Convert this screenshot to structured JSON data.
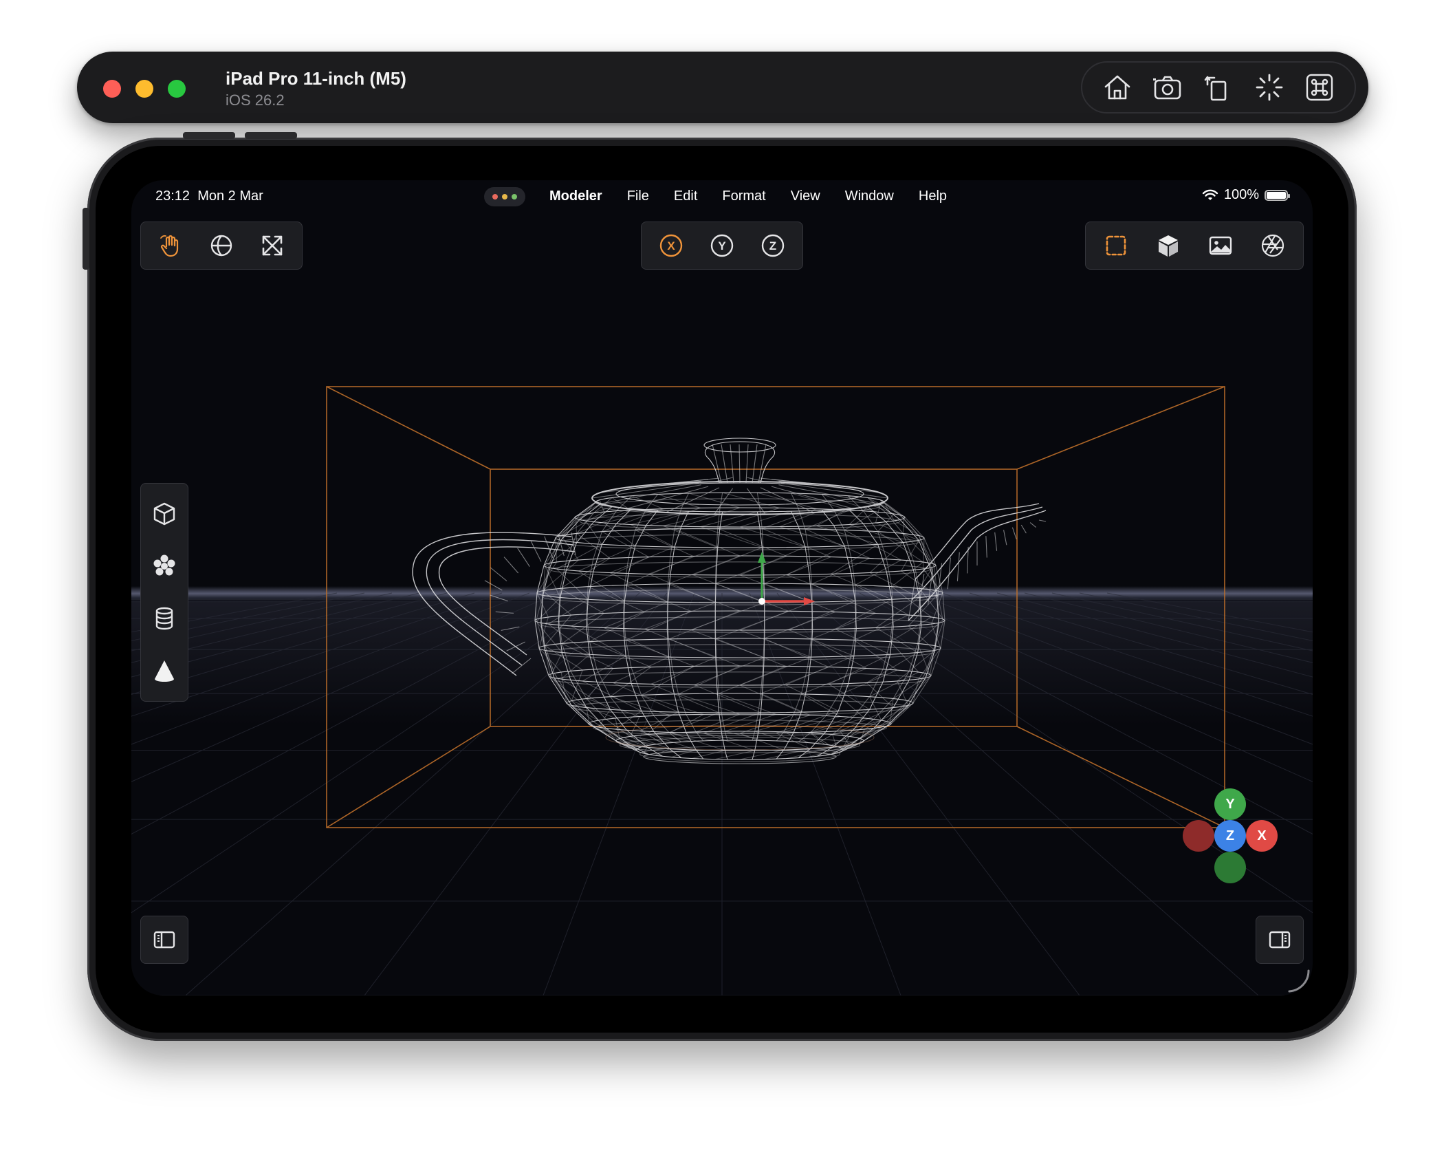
{
  "simulator": {
    "device_name": "iPad Pro 11-inch (M5)",
    "os_version": "iOS 26.2",
    "toolbar": [
      {
        "name": "home-icon",
        "label": "Home"
      },
      {
        "name": "camera-icon",
        "label": "Screenshot"
      },
      {
        "name": "rotate-icon",
        "label": "Rotate"
      },
      {
        "name": "loading-icon",
        "label": "Activity"
      },
      {
        "name": "command-icon",
        "label": "Keyboard"
      }
    ]
  },
  "status_bar": {
    "time": "23:12",
    "date": "Mon 2 Mar",
    "battery": "100%",
    "battery_level": 1.0
  },
  "menu_bar": {
    "app_name": "Modeler",
    "items": [
      "File",
      "Edit",
      "Format",
      "View",
      "Window",
      "Help"
    ]
  },
  "toolbar_left": {
    "items": [
      {
        "name": "hand-pan-icon",
        "active": true
      },
      {
        "name": "globe-orbit-icon",
        "active": false
      },
      {
        "name": "expand-arrows-icon",
        "active": false
      }
    ]
  },
  "toolbar_axis": {
    "items": [
      {
        "name": "axis-x-icon",
        "glyph": "X",
        "active": true
      },
      {
        "name": "axis-y-icon",
        "glyph": "Y",
        "active": false
      },
      {
        "name": "axis-z-icon",
        "glyph": "Z",
        "active": false
      }
    ]
  },
  "toolbar_right": {
    "items": [
      {
        "name": "selection-box-icon",
        "active": true
      },
      {
        "name": "solid-cube-icon",
        "active": false
      },
      {
        "name": "image-icon",
        "active": false
      },
      {
        "name": "aperture-icon",
        "active": false
      }
    ]
  },
  "primitives_toolbar": {
    "items": [
      {
        "name": "cube-outline-icon"
      },
      {
        "name": "sphere-cluster-icon"
      },
      {
        "name": "cylinder-icon"
      },
      {
        "name": "cone-icon"
      }
    ]
  },
  "gizmo": {
    "y_label": "Y",
    "x_label": "X",
    "z_label": "Z"
  },
  "colors": {
    "accent": "#f0943a",
    "bounding_box": "#c0702a",
    "axis_x": "#e04a45",
    "axis_y": "#3fa84a",
    "axis_z": "#3c82e6",
    "wireframe": "#e8e8ea",
    "viewport_bg": "#07080d"
  }
}
